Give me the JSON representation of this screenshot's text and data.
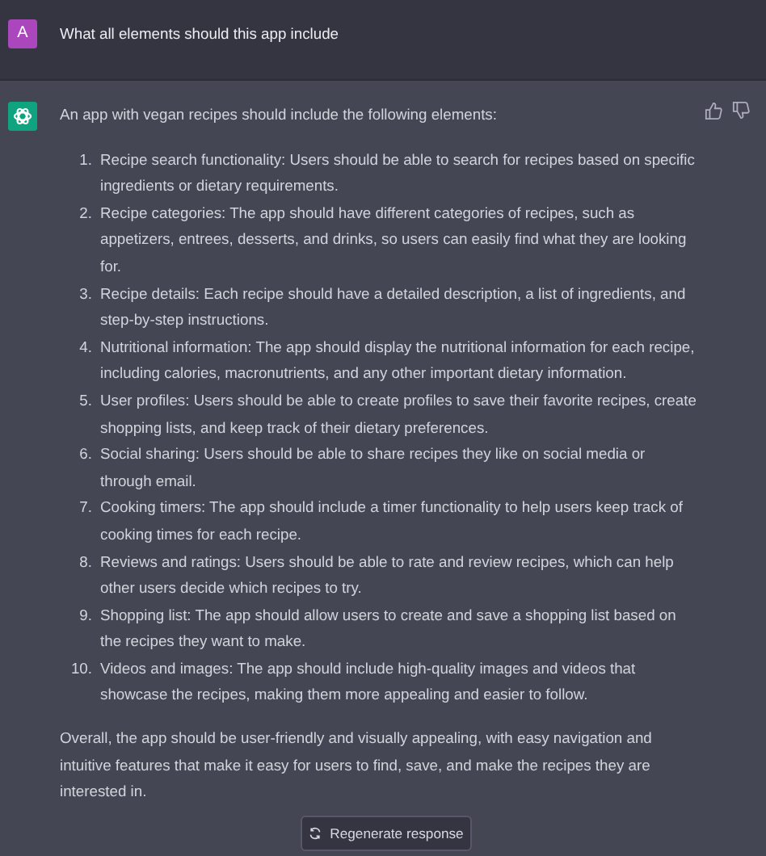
{
  "user_message": {
    "avatar": "A",
    "text": "What all elements should this app include"
  },
  "assistant_message": {
    "intro": "An app with vegan recipes should include the following elements:",
    "items": [
      {
        "number": "1.",
        "text": "Recipe search functionality: Users should be able to search for recipes based on specific ingredients or dietary requirements."
      },
      {
        "number": "2.",
        "text": "Recipe categories: The app should have different categories of recipes, such as appetizers, entrees, desserts, and drinks, so users can easily find what they are looking for."
      },
      {
        "number": "3.",
        "text": "Recipe details: Each recipe should have a detailed description, a list of ingredients, and step-by-step instructions."
      },
      {
        "number": "4.",
        "text": "Nutritional information: The app should display the nutritional information for each recipe, including calories, macronutrients, and any other important dietary information."
      },
      {
        "number": "5.",
        "text": "User profiles: Users should be able to create profiles to save their favorite recipes, create shopping lists, and keep track of their dietary preferences."
      },
      {
        "number": "6.",
        "text": "Social sharing: Users should be able to share recipes they like on social media or through email."
      },
      {
        "number": "7.",
        "text": "Cooking timers: The app should include a timer functionality to help users keep track of cooking times for each recipe."
      },
      {
        "number": "8.",
        "text": "Reviews and ratings: Users should be able to rate and review recipes, which can help other users decide which recipes to try."
      },
      {
        "number": "9.",
        "text": "Shopping list: The app should allow users to create and save a shopping list based on the recipes they want to make."
      },
      {
        "number": "10.",
        "text": "Videos and images: The app should include high-quality images and videos that showcase the recipes, making them more appealing and easier to follow."
      }
    ],
    "outro": "Overall, the app should be user-friendly and visually appealing, with easy navigation and intuitive features that make it easy for users to find, save, and make the recipes they are interested in."
  },
  "regenerate_button": {
    "label": "Regenerate response"
  }
}
